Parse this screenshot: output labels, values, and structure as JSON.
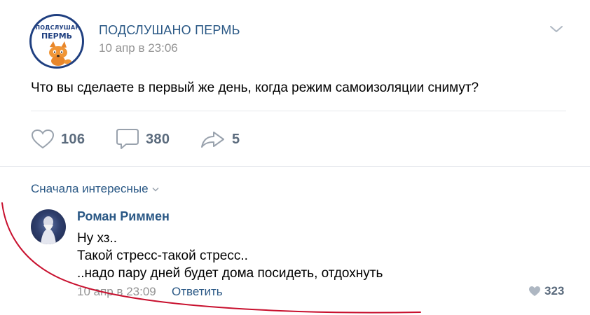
{
  "post": {
    "avatar_text_top": "«ПОДСЛУШАНО»",
    "avatar_text_bottom": "ПЕРМЬ",
    "group_name": "ПОДСЛУШАНО ПЕРМЬ",
    "time": "10 апр в 23:06",
    "text": "Что вы сделаете в первый же день, когда режим самоизоляции снимут?",
    "likes": "106",
    "comments": "380",
    "shares": "5"
  },
  "comments": {
    "sort_label": "Сначала интересные",
    "items": [
      {
        "author": "Роман Риммен",
        "lines": [
          "Ну хз..",
          "Такой стресс-такой стресс..",
          "..надо пару дней будет дома посидеть, отдохнуть"
        ],
        "time": "10 апр в 23:09",
        "reply_label": "Ответить",
        "likes": "323"
      }
    ]
  },
  "colors": {
    "link": "#2a5885",
    "muted": "#939393",
    "counter": "#5b6b7d",
    "annotation": "#c8102e"
  },
  "icons": [
    "chevron-down-icon",
    "heart-icon",
    "comment-icon",
    "share-icon",
    "small-heart-icon"
  ]
}
